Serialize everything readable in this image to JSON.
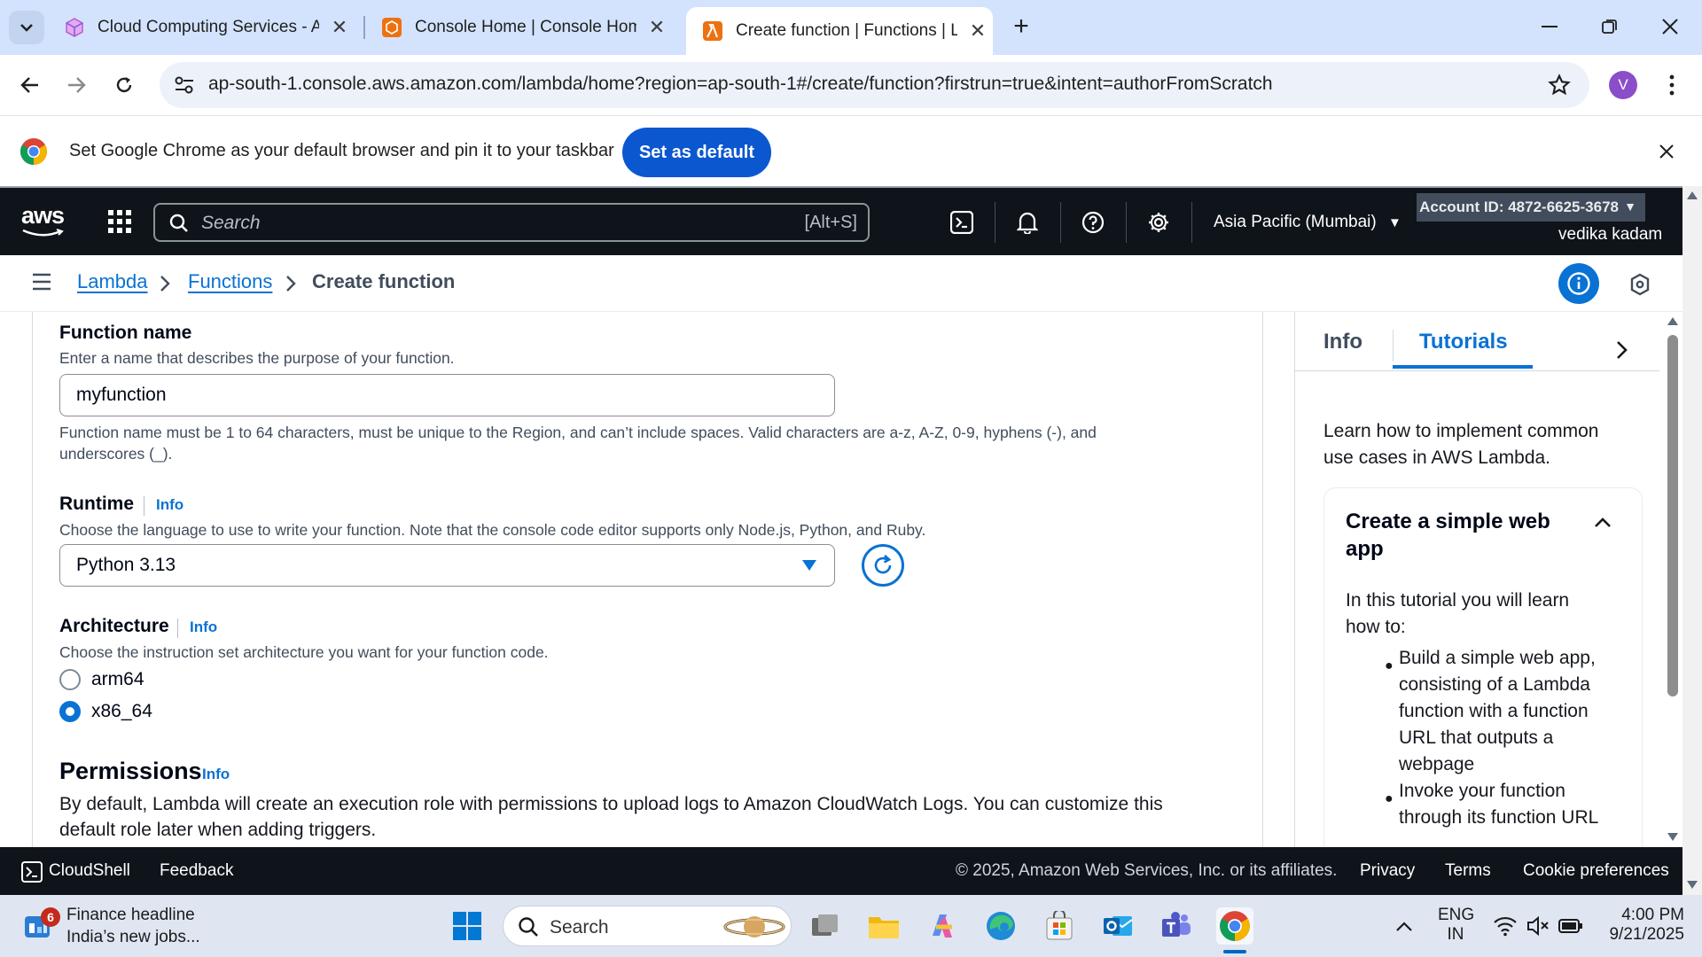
{
  "browser": {
    "tabs": [
      {
        "title": "Cloud Computing Services - Am",
        "icon": "aws-cube-icon",
        "active": false
      },
      {
        "title": "Console Home | Console Home",
        "icon": "aws-console-icon",
        "active": false
      },
      {
        "title": "Create function | Functions | Lar",
        "icon": "lambda-icon",
        "active": true
      }
    ],
    "new_tab": "+",
    "url": "ap-south-1.console.aws.amazon.com/lambda/home?region=ap-south-1#/create/function?firstrun=true&intent=authorFromScratch",
    "profile_initial": "V"
  },
  "infobar": {
    "message": "Set Google Chrome as your default browser and pin it to your taskbar",
    "button": "Set as default"
  },
  "aws_header": {
    "logo": "aws",
    "search_placeholder": "Search",
    "search_shortcut": "[Alt+S]",
    "region": "Asia Pacific (Mumbai)",
    "account": "Account ID: 4872-6625-3678",
    "user": "vedika kadam"
  },
  "breadcrumb": {
    "items": [
      "Lambda",
      "Functions"
    ],
    "current": "Create function"
  },
  "form": {
    "function_name": {
      "label": "Function name",
      "description": "Enter a name that describes the purpose of your function.",
      "value": "myfunction",
      "constraint_line1": "Function name must be 1 to 64 characters, must be unique to the Region, and can’t include spaces. Valid characters are a-z, A-Z, 0-9, hyphens (-), and",
      "constraint_line2": "underscores (_)."
    },
    "runtime": {
      "label": "Runtime",
      "info": "Info",
      "description": "Choose the language to use to write your function. Note that the console code editor supports only Node.js, Python, and Ruby.",
      "selected": "Python 3.13"
    },
    "architecture": {
      "label": "Architecture",
      "info": "Info",
      "description": "Choose the instruction set architecture you want for your function code.",
      "options": [
        "arm64",
        "x86_64"
      ],
      "selected": "x86_64"
    },
    "permissions": {
      "heading": "Permissions",
      "info": "Info",
      "description_line1": "By default, Lambda will create an execution role with permissions to upload logs to Amazon CloudWatch Logs. You can customize this",
      "description_line2": "default role later when adding triggers."
    }
  },
  "side_panel": {
    "tabs": [
      "Info",
      "Tutorials"
    ],
    "active_tab": "Tutorials",
    "intro_line1": "Learn how to implement common",
    "intro_line2": "use cases in AWS Lambda.",
    "tutorial": {
      "title_line1": "Create a simple web",
      "title_line2": "app",
      "lead_line1": "In this tutorial you will learn",
      "lead_line2": "how to:",
      "bullets": [
        [
          "Build a simple web app,",
          "consisting of a Lambda",
          "function with a function",
          "URL that outputs a",
          "webpage"
        ],
        [
          "Invoke your function",
          "through its function URL"
        ]
      ]
    }
  },
  "aws_footer": {
    "cloudshell": "CloudShell",
    "feedback": "Feedback",
    "copyright": "© 2025, Amazon Web Services, Inc. or its affiliates.",
    "links": [
      "Privacy",
      "Terms",
      "Cookie preferences"
    ]
  },
  "taskbar": {
    "news_badge": "6",
    "news_title": "Finance headline",
    "news_sub": "India’s new jobs...",
    "search": "Search",
    "lang_line1": "ENG",
    "lang_line2": "IN",
    "time": "4:00 PM",
    "date": "9/21/2025"
  },
  "colors": {
    "aws_dark": "#0f141a",
    "aws_link": "#0972d3",
    "chrome_tabstrip": "#d3e3fd",
    "chrome_button": "#0b57d0"
  }
}
